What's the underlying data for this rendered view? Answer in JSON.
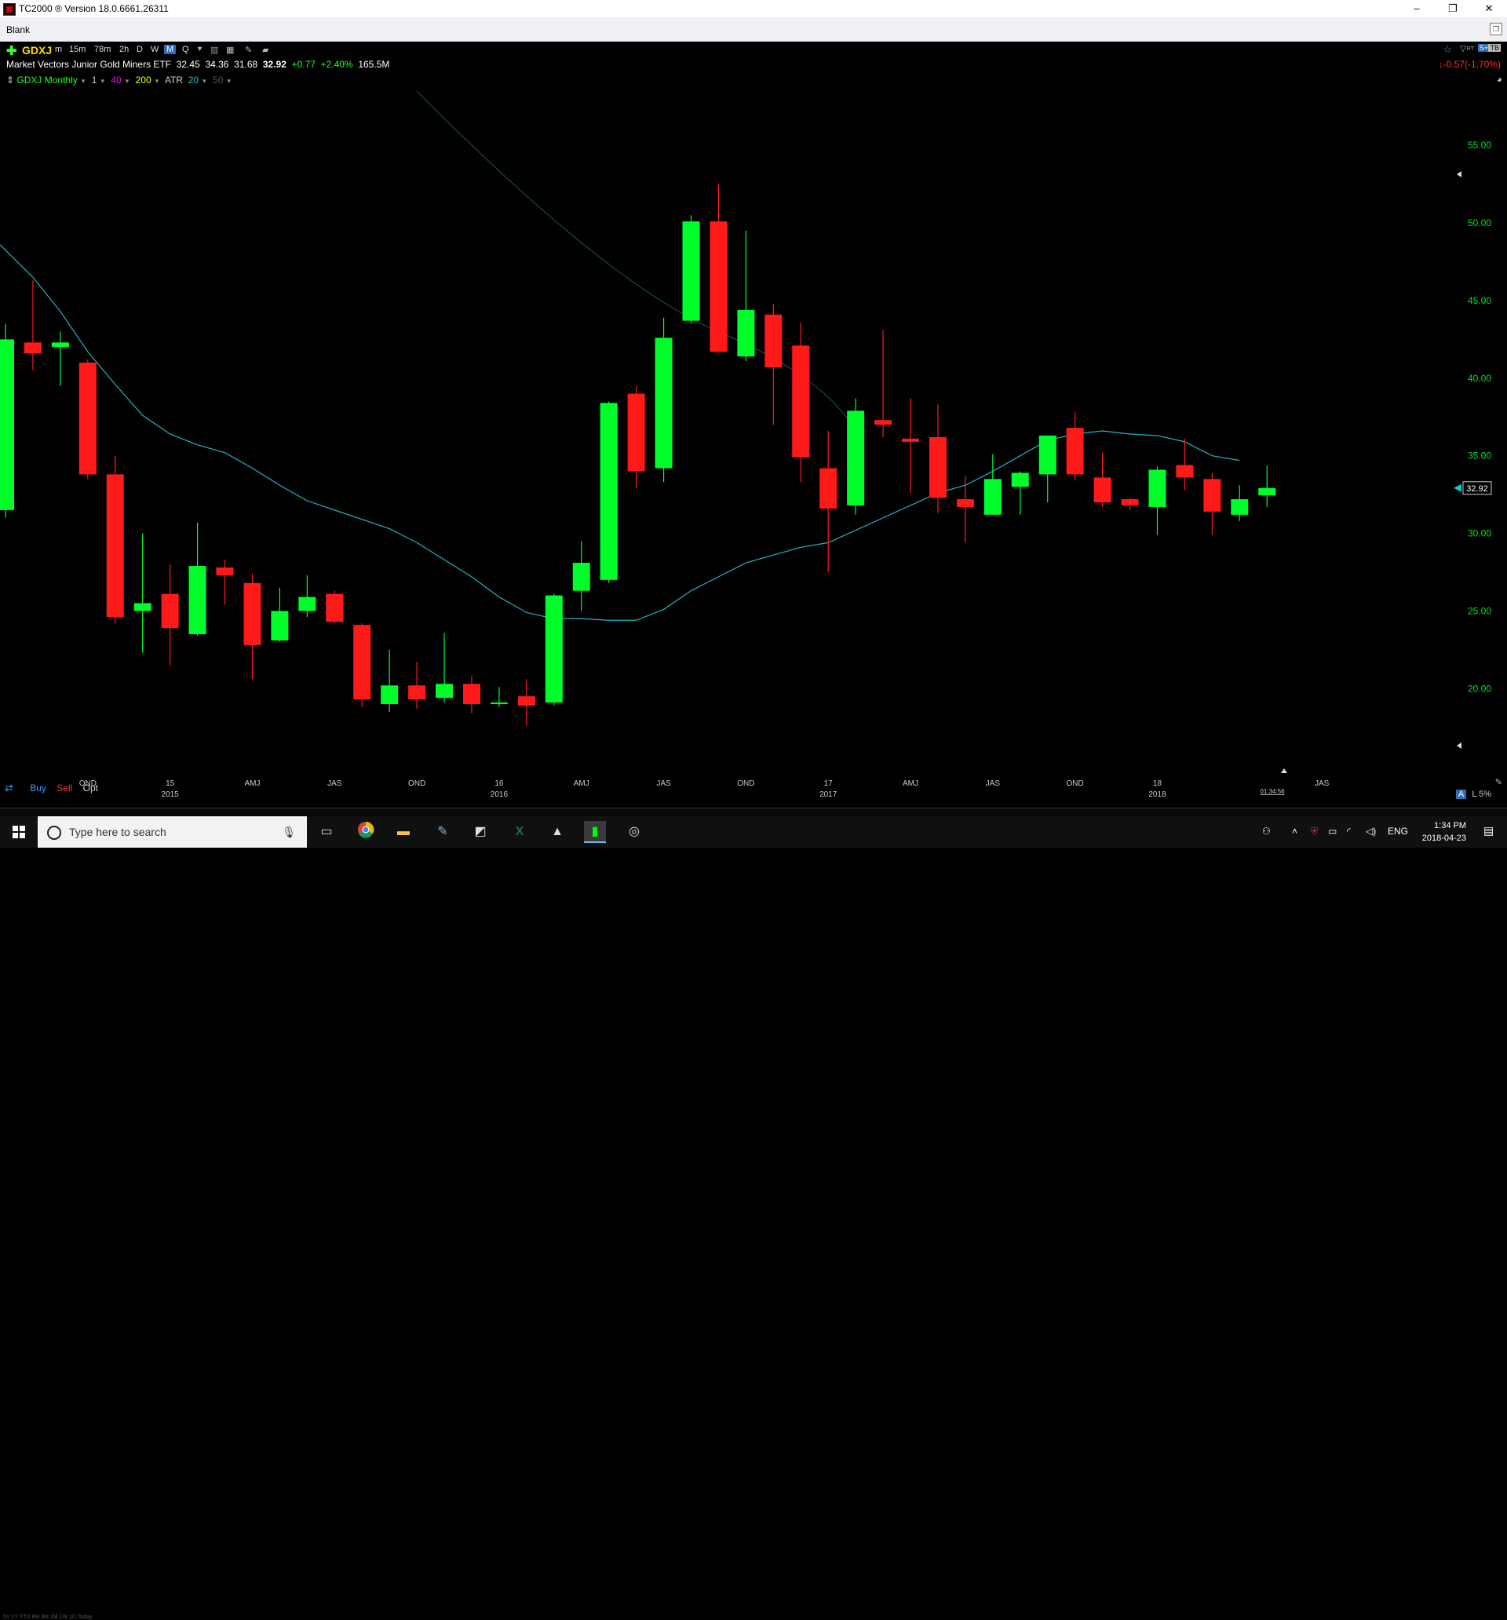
{
  "window": {
    "title": "TC2000 ® Version 18.0.6661.26311",
    "minimize": "–",
    "maximize": "❐",
    "close": "✕"
  },
  "tab": {
    "name": "Blank"
  },
  "toolbar": {
    "symbol": "GDXJ",
    "timeframes": [
      "m",
      "15m",
      "78m",
      "2h",
      "D",
      "W",
      "M",
      "Q"
    ],
    "active_timeframe": "M"
  },
  "quote": {
    "name": "Market Vectors Junior Gold Miners ETF",
    "open": "32.45",
    "high": "34.36",
    "low": "31.68",
    "last": "32.92",
    "change": "+0.77",
    "change_pct": "+2.40%",
    "volume": "165.5M",
    "right_change": "-0.57(-1.70%)"
  },
  "indicators": {
    "chart_label": "GDXJ Monthly",
    "n1": "1",
    "n40": "40",
    "n200": "200",
    "atr_label": "ATR",
    "atr_n": "20",
    "n50": "50"
  },
  "trade": {
    "buy": "Buy",
    "sell": "Sell",
    "opt": "Opt"
  },
  "scale_tabs": "5Y  1Y  YTD  6M  3M  1M  1W  1D  Today",
  "bottom_right": {
    "a": "A",
    "l": "L",
    "pct": "5%"
  },
  "time_readout": "01:34:56",
  "taskbar": {
    "search_placeholder": "Type here to search",
    "lang": "ENG",
    "time": "1:34 PM",
    "date": "2018-04-23"
  },
  "colors": {
    "up": "#00ff2a",
    "down": "#ff1a1a",
    "ma": "#1fb5c4",
    "axis_text": "#00e22a",
    "background": "#000000"
  },
  "chart_data": {
    "type": "candlestick",
    "title": "GDXJ Monthly",
    "y_ticks": [
      20,
      25,
      30,
      35,
      40,
      45,
      50,
      55
    ],
    "y_tick_labels": [
      "20.00",
      "25.00",
      "30.00",
      "35.00",
      "40.00",
      "45.00",
      "50.00",
      "55.00"
    ],
    "ylim": [
      14.5,
      58.4
    ],
    "last_price_label": "32.92",
    "x_labels": [
      {
        "top": "OND",
        "bottom": "",
        "i": 3
      },
      {
        "top": "15",
        "bottom": "2015",
        "i": 6
      },
      {
        "top": "AMJ",
        "bottom": "",
        "i": 9
      },
      {
        "top": "JAS",
        "bottom": "",
        "i": 12
      },
      {
        "top": "OND",
        "bottom": "",
        "i": 15
      },
      {
        "top": "16",
        "bottom": "2016",
        "i": 18
      },
      {
        "top": "AMJ",
        "bottom": "",
        "i": 21
      },
      {
        "top": "JAS",
        "bottom": "",
        "i": 24
      },
      {
        "top": "OND",
        "bottom": "",
        "i": 27
      },
      {
        "top": "17",
        "bottom": "2017",
        "i": 30
      },
      {
        "top": "AMJ",
        "bottom": "",
        "i": 33
      },
      {
        "top": "JAS",
        "bottom": "",
        "i": 36
      },
      {
        "top": "OND",
        "bottom": "",
        "i": 39
      },
      {
        "top": "18",
        "bottom": "2018",
        "i": 42
      },
      {
        "top": "JAS",
        "bottom": "",
        "i": 48
      }
    ],
    "candles": [
      {
        "o": 31.5,
        "h": 43.5,
        "l": 31.0,
        "c": 42.5
      },
      {
        "o": 42.3,
        "h": 46.3,
        "l": 40.5,
        "c": 41.6
      },
      {
        "o": 42.0,
        "h": 43.0,
        "l": 39.5,
        "c": 42.3
      },
      {
        "o": 41.0,
        "h": 41.2,
        "l": 33.5,
        "c": 33.8
      },
      {
        "o": 33.8,
        "h": 35.0,
        "l": 24.2,
        "c": 24.6
      },
      {
        "o": 25.0,
        "h": 30.0,
        "l": 22.3,
        "c": 25.5
      },
      {
        "o": 26.1,
        "h": 28.0,
        "l": 21.5,
        "c": 23.9
      },
      {
        "o": 23.5,
        "h": 30.7,
        "l": 23.4,
        "c": 27.9
      },
      {
        "o": 27.8,
        "h": 28.3,
        "l": 25.4,
        "c": 27.3
      },
      {
        "o": 26.8,
        "h": 27.4,
        "l": 20.6,
        "c": 22.8
      },
      {
        "o": 23.1,
        "h": 26.5,
        "l": 23.0,
        "c": 25.0
      },
      {
        "o": 25.0,
        "h": 27.3,
        "l": 24.6,
        "c": 25.9
      },
      {
        "o": 26.1,
        "h": 26.3,
        "l": 24.2,
        "c": 24.3
      },
      {
        "o": 24.1,
        "h": 24.2,
        "l": 18.8,
        "c": 19.3
      },
      {
        "o": 19.0,
        "h": 22.5,
        "l": 18.5,
        "c": 20.2
      },
      {
        "o": 20.2,
        "h": 21.7,
        "l": 18.7,
        "c": 19.3
      },
      {
        "o": 19.4,
        "h": 23.6,
        "l": 19.1,
        "c": 20.3
      },
      {
        "o": 20.3,
        "h": 20.8,
        "l": 18.4,
        "c": 19.0
      },
      {
        "o": 19.0,
        "h": 20.1,
        "l": 18.8,
        "c": 19.1
      },
      {
        "o": 19.5,
        "h": 20.6,
        "l": 17.6,
        "c": 18.9
      },
      {
        "o": 19.1,
        "h": 26.1,
        "l": 18.9,
        "c": 26.0
      },
      {
        "o": 26.3,
        "h": 29.5,
        "l": 25.0,
        "c": 28.1
      },
      {
        "o": 27.0,
        "h": 38.5,
        "l": 26.8,
        "c": 38.4
      },
      {
        "o": 39.0,
        "h": 39.5,
        "l": 32.9,
        "c": 34.0
      },
      {
        "o": 34.2,
        "h": 43.9,
        "l": 33.3,
        "c": 42.6
      },
      {
        "o": 43.7,
        "h": 50.5,
        "l": 43.5,
        "c": 50.1
      },
      {
        "o": 50.1,
        "h": 52.5,
        "l": 41.6,
        "c": 41.7
      },
      {
        "o": 41.4,
        "h": 49.5,
        "l": 41.1,
        "c": 44.4
      },
      {
        "o": 44.1,
        "h": 44.8,
        "l": 37.0,
        "c": 40.7
      },
      {
        "o": 42.1,
        "h": 43.6,
        "l": 33.3,
        "c": 34.9
      },
      {
        "o": 34.2,
        "h": 36.6,
        "l": 27.5,
        "c": 31.6
      },
      {
        "o": 31.8,
        "h": 38.7,
        "l": 31.2,
        "c": 37.9
      },
      {
        "o": 37.3,
        "h": 43.1,
        "l": 36.2,
        "c": 37.0
      },
      {
        "o": 36.1,
        "h": 38.7,
        "l": 32.6,
        "c": 35.9
      },
      {
        "o": 36.2,
        "h": 38.3,
        "l": 31.3,
        "c": 32.3
      },
      {
        "o": 32.2,
        "h": 33.7,
        "l": 29.4,
        "c": 31.7
      },
      {
        "o": 31.2,
        "h": 35.1,
        "l": 31.2,
        "c": 33.5
      },
      {
        "o": 33.0,
        "h": 34.0,
        "l": 31.2,
        "c": 33.9
      },
      {
        "o": 33.8,
        "h": 36.3,
        "l": 32.0,
        "c": 36.3
      },
      {
        "o": 36.8,
        "h": 37.8,
        "l": 33.4,
        "c": 33.8
      },
      {
        "o": 33.6,
        "h": 35.2,
        "l": 31.7,
        "c": 32.0
      },
      {
        "o": 32.2,
        "h": 32.3,
        "l": 31.5,
        "c": 31.8
      },
      {
        "o": 31.7,
        "h": 34.3,
        "l": 29.9,
        "c": 34.1
      },
      {
        "o": 34.4,
        "h": 36.1,
        "l": 32.8,
        "c": 33.6
      },
      {
        "o": 33.5,
        "h": 33.9,
        "l": 29.9,
        "c": 31.4
      },
      {
        "o": 31.2,
        "h": 33.1,
        "l": 30.8,
        "c": 32.2
      },
      {
        "o": 32.45,
        "h": 34.36,
        "l": 31.68,
        "c": 32.92
      }
    ],
    "ma": [
      48.6,
      46.5,
      44.3,
      41.7,
      39.6,
      37.6,
      36.4,
      35.7,
      35.2,
      34.2,
      33.1,
      32.1,
      31.5,
      30.9,
      30.3,
      29.4,
      28.3,
      27.2,
      25.9,
      24.9,
      24.5,
      24.5,
      24.4,
      24.4,
      25.1,
      26.3,
      27.2,
      28.1,
      28.6,
      29.1,
      29.4,
      30.2,
      31.0,
      31.8,
      32.6,
      33.1,
      34.0,
      35.0,
      36.0,
      36.4,
      36.6,
      36.4,
      36.3,
      35.9,
      35.0,
      34.7
    ],
    "ma_start_index": 0,
    "ma_label": "ATR 20"
  }
}
